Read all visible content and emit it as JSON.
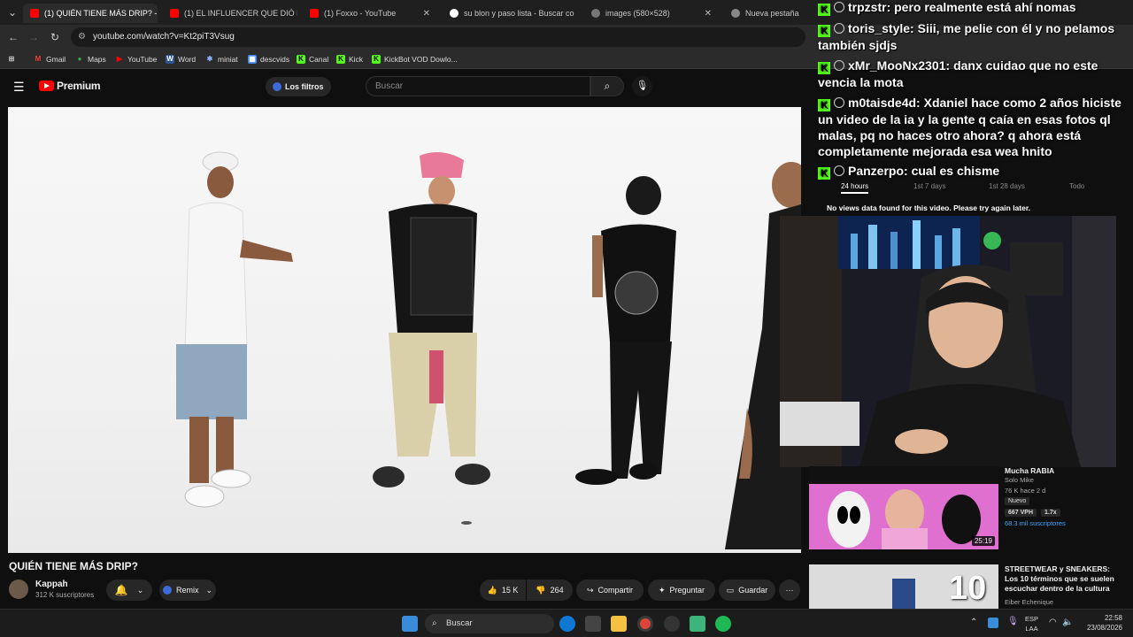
{
  "browser": {
    "tabs": [
      {
        "title": "(1) QUIÉN TIENE MÁS DRIP? - Y",
        "favicon": "youtube-icon",
        "active": true
      },
      {
        "title": "(1) EL INFLUENCER QUE DIÓ D",
        "favicon": "youtube-icon",
        "active": false
      },
      {
        "title": "(1) Foxxo - YouTube",
        "favicon": "youtube-icon",
        "active": false
      },
      {
        "title": "su blon y paso lista - Buscar co",
        "favicon": "google-icon",
        "active": false
      },
      {
        "title": "images (580×528)",
        "favicon": "globe-icon",
        "active": false
      },
      {
        "title": "Nueva pestaña",
        "favicon": "chrome-icon",
        "active": false
      }
    ],
    "url": "youtube.com/watch?v=Kt2piT3Vsug",
    "bookmarks": [
      {
        "label": "Gmail",
        "icon": "gmail-icon",
        "color": "#ea4335"
      },
      {
        "label": "Maps",
        "icon": "maps-icon",
        "color": "#34a853"
      },
      {
        "label": "YouTube",
        "icon": "youtube-icon",
        "color": "#ff0000"
      },
      {
        "label": "Word",
        "icon": "word-icon",
        "color": "#2b579a"
      },
      {
        "label": "miniat",
        "icon": "star-icon",
        "color": "#8ab4f8"
      },
      {
        "label": "descvids",
        "icon": "grid-icon",
        "color": "#4285f4"
      },
      {
        "label": "Canal",
        "icon": "kick-icon",
        "color": "#53fc18"
      },
      {
        "label": "Kick",
        "icon": "kick-icon",
        "color": "#53fc18"
      },
      {
        "label": "KickBot VOD Dowlo...",
        "icon": "kick-icon",
        "color": "#53fc18"
      }
    ]
  },
  "youtube": {
    "logo": "Premium",
    "filters_chip": "Los filtros",
    "search_placeholder": "Buscar",
    "video_title": "QUIÉN TIENE MÁS DRIP?",
    "channel": {
      "name": "Kappah",
      "subscribers": "312 K suscriptores"
    },
    "actions": {
      "remix": "Remix",
      "likes": "15 K",
      "dislikes": "264",
      "share": "Compartir",
      "ask": "Preguntar",
      "save": "Guardar"
    }
  },
  "chat": [
    {
      "user": "trpzstr",
      "text": "pero realmente está ahí nomas"
    },
    {
      "user": "toris_style",
      "text": "Siii, me pelie con él y no pelamos también sjdjs"
    },
    {
      "user": "xMr_MooNx2301",
      "text": "danx cuidao que no este vencia la mota"
    },
    {
      "user": "m0taisde4d",
      "text": "Xdaniel hace como 2 años hiciste un video de la ia y la gente q caía en esas fotos ql malas, pq no haces otro ahora? q ahora está completamente mejorada esa wea hnito"
    },
    {
      "user": "Panzerpo",
      "text": "cual es chisme"
    }
  ],
  "analytics": {
    "tabs": [
      "24 hours",
      "1st 7 days",
      "1st 28 days",
      "Todo"
    ],
    "message": "No views data found for this video. Please try again later."
  },
  "recommendations": [
    {
      "title": "Mucha RABIA",
      "channel": "Solo Mike",
      "stats": "76 K   hace 2 d",
      "badge": "Nuevo",
      "vph": "667 VPH",
      "ratio": "1.7x",
      "subs": "68.3 mil suscriptores",
      "duration": "25:19"
    },
    {
      "title": "STREETWEAR y SNEAKERS: Los 10 términos que se suelen escuchar dentro de la cultura",
      "channel": "Eiber Echenique",
      "thumb_text": "10"
    }
  ],
  "taskbar": {
    "search_placeholder": "Buscar",
    "lang_top": "ESP",
    "lang_bottom": "LAA",
    "time": "22:58",
    "date": "23/08/2026"
  }
}
